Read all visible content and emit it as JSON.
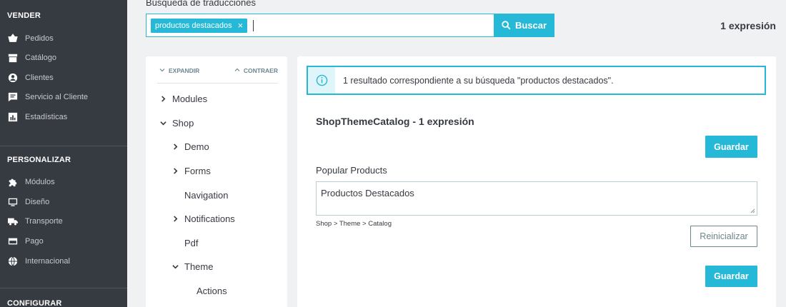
{
  "sidebar": {
    "sections": [
      {
        "title": "VENDER",
        "items": [
          {
            "label": "Pedidos",
            "icon": "cart-icon"
          },
          {
            "label": "Catálogo",
            "icon": "store-icon"
          },
          {
            "label": "Clientes",
            "icon": "user-icon"
          },
          {
            "label": "Servicio al Cliente",
            "icon": "chat-icon"
          },
          {
            "label": "Estadísticas",
            "icon": "chart-icon"
          }
        ]
      },
      {
        "title": "PERSONALIZAR",
        "items": [
          {
            "label": "Módulos",
            "icon": "puzzle-icon"
          },
          {
            "label": "Diseño",
            "icon": "monitor-icon"
          },
          {
            "label": "Transporte",
            "icon": "truck-icon"
          },
          {
            "label": "Pago",
            "icon": "card-icon"
          },
          {
            "label": "Internacional",
            "icon": "globe-icon"
          }
        ]
      },
      {
        "title": "CONFIGURAR",
        "items": []
      }
    ]
  },
  "search": {
    "label": "Búsqueda de traducciones",
    "tag": "productos destacados",
    "tag_close": "×",
    "button_label": "Buscar",
    "result_count": "1 expresión"
  },
  "tree": {
    "expand_label": "EXPANDIR",
    "collapse_label": "CONTRAER",
    "nodes": [
      {
        "label": "Modules",
        "chevron": "right"
      },
      {
        "label": "Shop",
        "chevron": "down"
      },
      {
        "label": "Demo",
        "chevron": "right"
      },
      {
        "label": "Forms",
        "chevron": "right"
      },
      {
        "label": "Navigation",
        "chevron": "none"
      },
      {
        "label": "Notifications",
        "chevron": "right"
      },
      {
        "label": "Pdf",
        "chevron": "none"
      },
      {
        "label": "Theme",
        "chevron": "down"
      },
      {
        "label": "Actions",
        "chevron": "none"
      }
    ]
  },
  "main": {
    "alert_text": "1 resultado correspondiente a su búsqueda \"productos destacados\".",
    "domain_title": "ShopThemeCatalog - 1 expresión",
    "save_label": "Guardar",
    "field_label": "Popular Products",
    "field_value": "Productos Destacados",
    "path": "Shop > Theme > Catalog",
    "reset_label": "Reinicializar"
  },
  "colors": {
    "accent": "#25b9d7",
    "sidebar_bg": "#363a41",
    "page_bg": "#eff1f2"
  }
}
